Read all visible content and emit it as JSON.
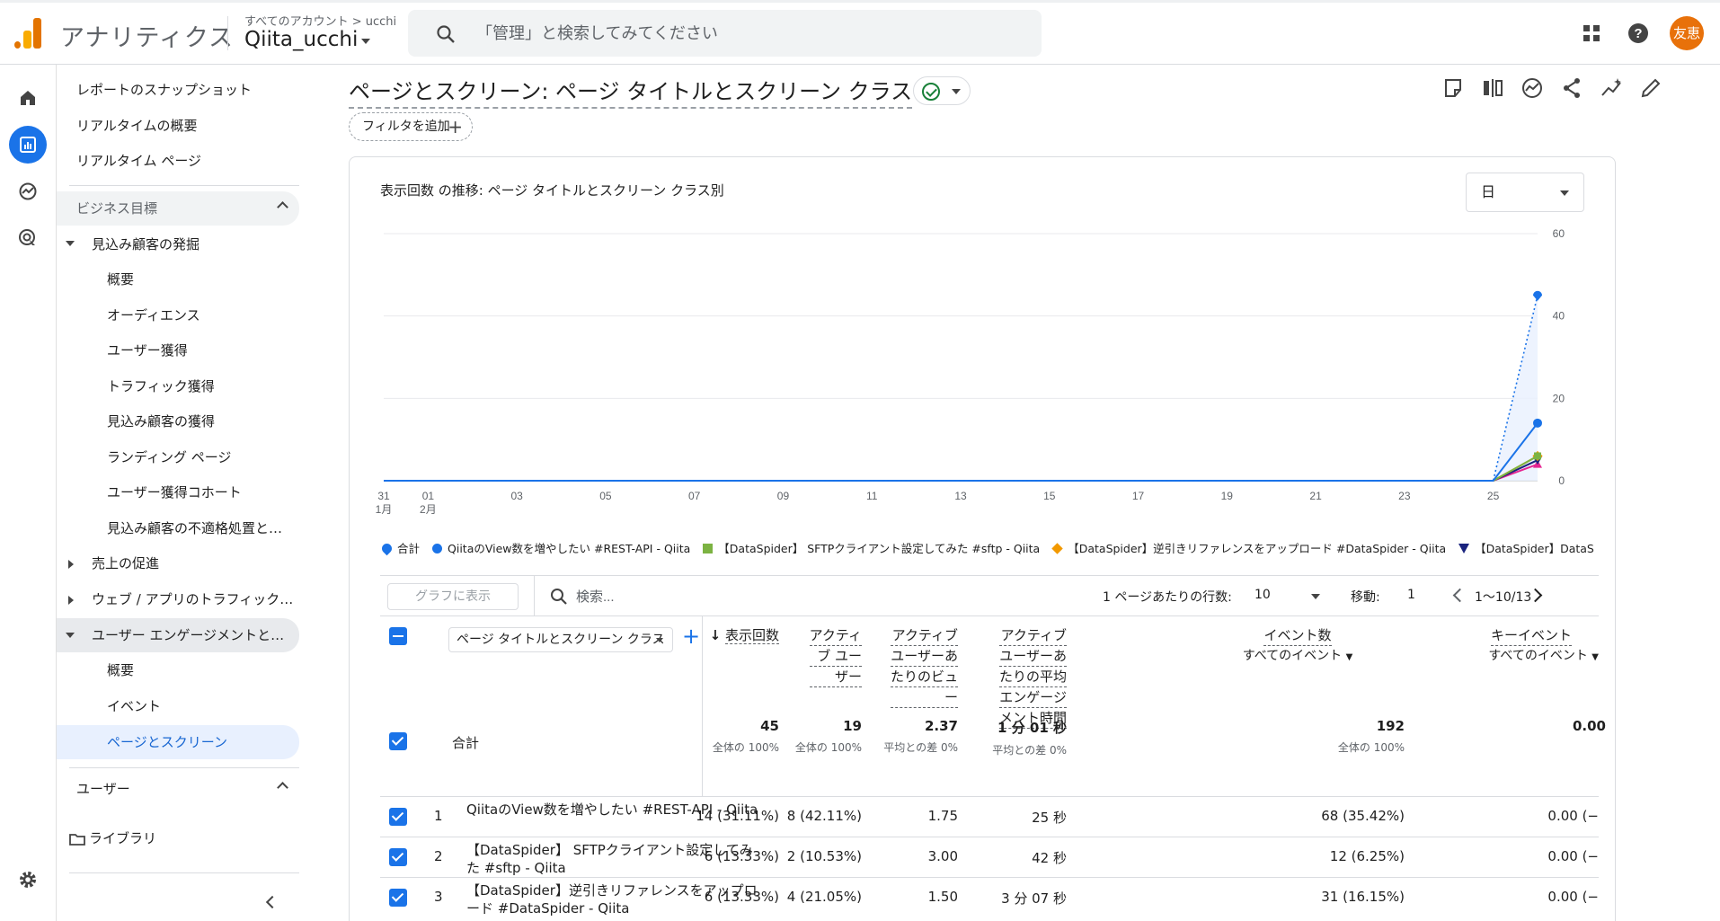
{
  "app": {
    "brand": "アナリティクス",
    "account_breadcrumb": "すべてのアカウント > ucchi",
    "property_name": "Qiita_ucchi",
    "search_placeholder": "「管理」と検索してみてください",
    "avatar_text": "友恵"
  },
  "sidebar": {
    "top_items": [
      "レポートのスナップショット",
      "リアルタイムの概要",
      "リアルタイム ページ"
    ],
    "section_business": "ビジネス目標",
    "group_leads": "見込み顧客の発掘",
    "lead_items": [
      "概要",
      "オーディエンス",
      "ユーザー獲得",
      "トラフィック獲得",
      "見込み顧客の獲得",
      "ランディング ページ",
      "ユーザー獲得コホート",
      "見込み顧客の不適格処置と…"
    ],
    "group_sales": "売上の促進",
    "group_traffic": "ウェブ / アプリのトラフィック…",
    "group_engagement": "ユーザー エンゲージメントと…",
    "engagement_items": [
      "概要",
      "イベント",
      "ページとスクリーン"
    ],
    "section_user": "ユーザー",
    "library": "ライブラリ"
  },
  "report": {
    "title": "ページとスクリーン: ページ タイトルとスクリーン クラス",
    "filter_chip": "フィルタを追加",
    "chart_title": "表示回数 の推移: ページ タイトルとスクリーン クラス別",
    "granularity": "日"
  },
  "chart_data": {
    "type": "line",
    "x_ticks": [
      "31",
      "01",
      "03",
      "05",
      "07",
      "09",
      "11",
      "13",
      "15",
      "17",
      "19",
      "21",
      "23",
      "25"
    ],
    "x_month_labels": [
      "1月",
      "2月"
    ],
    "y_ticks": [
      "60",
      "40",
      "20",
      "0"
    ],
    "ylim": [
      0,
      60
    ],
    "x_dates": [
      "1/31",
      "2/1",
      "2/2",
      "2/3",
      "2/4",
      "2/5",
      "2/6",
      "2/7",
      "2/8",
      "2/9",
      "2/10",
      "2/11",
      "2/12",
      "2/13",
      "2/14",
      "2/15",
      "2/16",
      "2/17",
      "2/18",
      "2/19",
      "2/20",
      "2/21",
      "2/22",
      "2/23",
      "2/24",
      "2/25",
      "2/26"
    ],
    "series": [
      {
        "name": "合計",
        "color": "#1a73e8",
        "style": "dotted",
        "values": [
          0,
          0,
          0,
          0,
          0,
          0,
          0,
          0,
          0,
          0,
          0,
          0,
          0,
          0,
          0,
          0,
          0,
          0,
          0,
          0,
          0,
          0,
          0,
          0,
          0,
          0,
          45
        ]
      },
      {
        "name": "QiitaのView数を増やしたい #REST-API - Qiita",
        "color": "#1a73e8",
        "values": [
          0,
          0,
          0,
          0,
          0,
          0,
          0,
          0,
          0,
          0,
          0,
          0,
          0,
          0,
          0,
          0,
          0,
          0,
          0,
          0,
          0,
          0,
          0,
          0,
          0,
          0,
          14
        ]
      },
      {
        "name": "【DataSpider】 SFTPクライアント設定してみた #sftp - Qiita",
        "color": "#7cb342",
        "values": [
          0,
          0,
          0,
          0,
          0,
          0,
          0,
          0,
          0,
          0,
          0,
          0,
          0,
          0,
          0,
          0,
          0,
          0,
          0,
          0,
          0,
          0,
          0,
          0,
          0,
          0,
          6
        ]
      },
      {
        "name": "【DataSpider】逆引きリファレンスをアップロード #DataSpider - Qiita",
        "color": "#f29900",
        "values": [
          0,
          0,
          0,
          0,
          0,
          0,
          0,
          0,
          0,
          0,
          0,
          0,
          0,
          0,
          0,
          0,
          0,
          0,
          0,
          0,
          0,
          0,
          0,
          0,
          0,
          0,
          6
        ]
      },
      {
        "name": "【DataSpider】DataSpi",
        "color": "#1a237e",
        "values": [
          0,
          0,
          0,
          0,
          0,
          0,
          0,
          0,
          0,
          0,
          0,
          0,
          0,
          0,
          0,
          0,
          0,
          0,
          0,
          0,
          0,
          0,
          0,
          0,
          0,
          0,
          5
        ]
      },
      {
        "name": "",
        "color": "#e52592",
        "values": [
          0,
          0,
          0,
          0,
          0,
          0,
          0,
          0,
          0,
          0,
          0,
          0,
          0,
          0,
          0,
          0,
          0,
          0,
          0,
          0,
          0,
          0,
          0,
          0,
          0,
          0,
          4
        ]
      }
    ]
  },
  "table": {
    "show_in_graph": "グラフに表示",
    "search_placeholder": "検索...",
    "rows_per_page_label": "1 ページあたりの行数:",
    "rows_per_page": "10",
    "goto_label": "移動:",
    "goto_value": "1",
    "range": "1〜10/13",
    "dimension": "ページ タイトルとスクリーン クラス",
    "headers": {
      "views": "表示回数",
      "active_users": [
        "アクティ",
        "ブ ユー",
        "ザー"
      ],
      "views_per_user": [
        "アクティブ",
        "ユーザーあ",
        "たりのビュ",
        "ー"
      ],
      "avg_engagement": [
        "アクティブ",
        "ユーザーあ",
        "たりの平均",
        "エンゲージ",
        "メント時間"
      ],
      "event_count": "イベント数",
      "event_count_sub": "すべてのイベント",
      "key_events": "キーイベント",
      "key_events_sub": "すべてのイベント"
    },
    "totals": {
      "label": "合計",
      "views": "45",
      "views_sub": "全体の 100%",
      "users": "19",
      "users_sub": "全体の 100%",
      "vpu": "2.37",
      "vpu_sub": "平均との差 0%",
      "eng": "1 分 01 秒",
      "eng_sub": "平均との差 0%",
      "events": "192",
      "events_sub": "全体の 100%",
      "key": "0.00"
    },
    "rows": [
      {
        "num": "1",
        "name": "QiitaのView数を増やしたい #REST-API - Qiita",
        "views": "14 (31.11%)",
        "users": "8 (42.11%)",
        "vpu": "1.75",
        "eng": "25 秒",
        "events": "68 (35.42%)",
        "key": "0.00 (−"
      },
      {
        "num": "2",
        "name": "【DataSpider】 SFTPクライアント設定してみた #sftp - Qiita",
        "views": "6 (13.33%)",
        "users": "2 (10.53%)",
        "vpu": "3.00",
        "eng": "42 秒",
        "events": "12 (6.25%)",
        "key": "0.00 (−"
      },
      {
        "num": "3",
        "name": "【DataSpider】逆引きリファレンスをアップロード #DataSpider - Qiita",
        "views": "6 (13.33%)",
        "users": "4 (21.05%)",
        "vpu": "1.50",
        "eng": "3 分 07 秒",
        "events": "31 (16.15%)",
        "key": "0.00 (−"
      }
    ]
  }
}
